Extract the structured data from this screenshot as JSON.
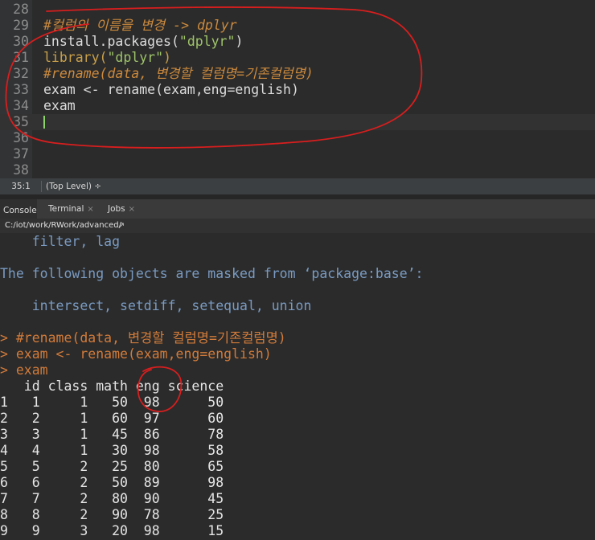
{
  "editor": {
    "lines": [
      {
        "num": "28",
        "text": ""
      },
      {
        "num": "29",
        "text": "#컬럼의 이름을 변경 -> dplyr",
        "kind": "comment"
      },
      {
        "num": "30",
        "text": "install.packages(\"dplyr\")",
        "kind": "install"
      },
      {
        "num": "31",
        "text": "library(\"dplyr\")",
        "kind": "library"
      },
      {
        "num": "32",
        "text": "#rename(data, 변경할 컬럼명=기존컬럼명)",
        "kind": "comment"
      },
      {
        "num": "33",
        "text": "exam <- rename(exam,eng=english)",
        "kind": "plain"
      },
      {
        "num": "34",
        "text": "exam",
        "kind": "plain"
      },
      {
        "num": "35",
        "text": "",
        "current": true
      },
      {
        "num": "36",
        "text": ""
      },
      {
        "num": "37",
        "text": ""
      },
      {
        "num": "38",
        "text": ""
      }
    ],
    "install_fn": "install.packages(",
    "install_arg": "\"dplyr\"",
    "install_close": ")",
    "library_fn": "library(",
    "library_arg": "\"dplyr\"",
    "library_close": ")"
  },
  "statusbar": {
    "cursor_pos": "35:1",
    "scope": "(Top Level) ÷"
  },
  "tabs": [
    {
      "label": "Console",
      "active": true,
      "closable": false
    },
    {
      "label": "Terminal",
      "active": false,
      "closable": true
    },
    {
      "label": "Jobs",
      "active": false,
      "closable": true
    }
  ],
  "tab_close_glyph": "×",
  "pathbar": {
    "path": "C:/iot/work/RWork/advanced/",
    "go_icon": "↗"
  },
  "console": {
    "lines": [
      {
        "text": "    filter, lag",
        "kind": "blue"
      },
      {
        "text": "",
        "kind": "blue"
      },
      {
        "text": "The following objects are masked from ‘package:base’:",
        "kind": "blue"
      },
      {
        "text": "",
        "kind": "blue"
      },
      {
        "text": "    intersect, setdiff, setequal, union",
        "kind": "blue"
      },
      {
        "text": "",
        "kind": "blue"
      },
      {
        "text": "> #rename(data, 변경할 컬럼명=기존컬럼명)",
        "kind": "cmd"
      },
      {
        "text": "> exam <- rename(exam,eng=english)",
        "kind": "cmd"
      },
      {
        "text": "> exam",
        "kind": "cmd"
      },
      {
        "text": "   id class math eng science",
        "kind": "out"
      },
      {
        "text": "1   1     1   50  98      50",
        "kind": "out"
      },
      {
        "text": "2   2     1   60  97      60",
        "kind": "out"
      },
      {
        "text": "3   3     1   45  86      78",
        "kind": "out"
      },
      {
        "text": "4   4     1   30  98      58",
        "kind": "out"
      },
      {
        "text": "5   5     2   25  80      65",
        "kind": "out"
      },
      {
        "text": "6   6     2   50  89      98",
        "kind": "out"
      },
      {
        "text": "7   7     2   80  90      45",
        "kind": "out"
      },
      {
        "text": "8   8     2   90  78      25",
        "kind": "out"
      },
      {
        "text": "9   9     3   20  98      15",
        "kind": "out"
      }
    ]
  },
  "colors": {
    "annotation": "#d81e1e",
    "cursor": "#8ad46a"
  }
}
